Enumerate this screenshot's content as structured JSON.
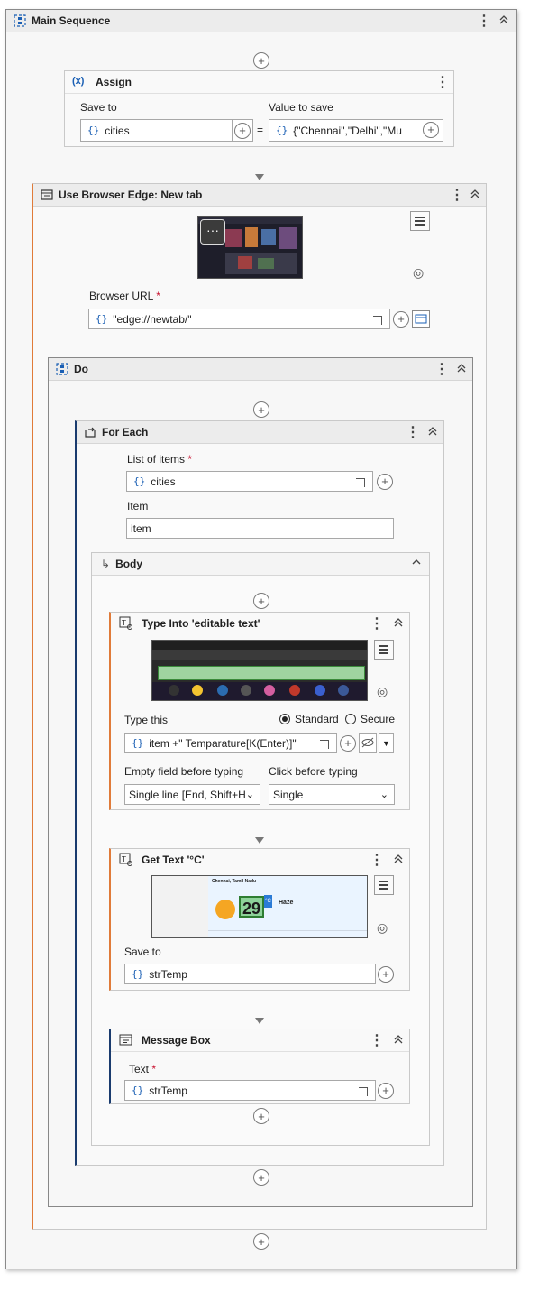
{
  "main_sequence": {
    "title": "Main Sequence"
  },
  "assign": {
    "title": "Assign",
    "icon_text": "(x)",
    "save_to_label": "Save to",
    "value_label": "Value to save",
    "save_to_value": "cities",
    "equals": "=",
    "value_text": "{\"Chennai\",\"Delhi\",\"Mu"
  },
  "browser": {
    "title": "Use Browser Edge: New tab",
    "url_label": "Browser URL",
    "url_value": "\"edge://newtab/\""
  },
  "do": {
    "title": "Do"
  },
  "foreach": {
    "title": "For Each",
    "list_label": "List of items",
    "list_value": "cities",
    "item_label": "Item",
    "item_value": "item"
  },
  "body": {
    "title": "Body"
  },
  "typeinto": {
    "title": "Type Into 'editable text'",
    "type_label": "Type this",
    "standard": "Standard",
    "secure": "Secure",
    "type_value": "item +\" Temparature[K(Enter)]\"",
    "empty_label": "Empty field before typing",
    "click_label": "Click before typing",
    "empty_value": "Single line [End, Shift+H",
    "click_value": "Single"
  },
  "gettext": {
    "title": "Get Text '°C'",
    "save_label": "Save to",
    "save_value": "strTemp",
    "weather_city": "Chennai, Tamil Nadu",
    "weather_temp": "29",
    "weather_unit": "°C",
    "weather_cond": "Haze"
  },
  "msgbox": {
    "title": "Message Box",
    "text_label": "Text",
    "text_value": "strTemp"
  },
  "common": {
    "brace": "{}",
    "plus": "+",
    "required": "*",
    "dots": "⋮",
    "collapse": "⌃"
  }
}
